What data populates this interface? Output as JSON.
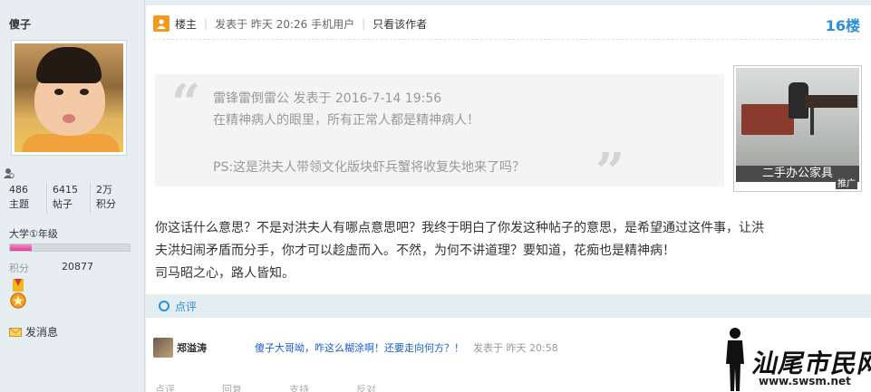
{
  "user": {
    "name": "傻子",
    "stats": [
      {
        "value": "486",
        "label": "主题"
      },
      {
        "value": "6415",
        "label": "帖子"
      },
      {
        "value": "2万",
        "label": "积分"
      }
    ],
    "grade": "大学①年级",
    "grade_progress": 0.18,
    "points_label": "积分",
    "points_value": "20877",
    "message_label": "发消息"
  },
  "post": {
    "host_label": "楼主",
    "posted_at": "发表于 昨天 20:26 手机用户",
    "author_only": "只看该作者",
    "floor": "16楼",
    "quote": {
      "line1": "雷锋雷倒雷公 发表于 2016-7-14 19:56",
      "line2": "在精神病人的眼里，所有正常人都是精神病人！",
      "line3": "PS:这是洪夫人带领文化版块虾兵蟹将收复失地来了吗？"
    },
    "body": {
      "line1": "你这话什么意思？不是对洪夫人有哪点意思吧？我终于明白了你发这种帖子的意思，是希望通过这件事，让洪",
      "line2": "夫洪妇闹矛盾而分手，你才可以趁虚而入。不然，为何不讲道理？要知道，花痴也是精神病！",
      "line3": "司马昭之心，路人皆知。"
    },
    "rate_label": "点评",
    "comment": {
      "user": "郑溢涛",
      "text": "傻子大哥呦，咋这么糊涂啊！还要走向何方？！",
      "time": "发表于 昨天 20:58"
    },
    "footer": [
      "点评",
      "回复",
      "支持",
      "反对"
    ]
  },
  "ad": {
    "caption": "二手办公家具",
    "tag": "推广"
  },
  "watermark": {
    "name": "汕尾市民网",
    "url": "www.swsm.net"
  },
  "colors": {
    "accent": "#2a8fd6",
    "host_icon": "#f19a1b",
    "comment_link": "#1b5fd1",
    "progress": "#de3f9c"
  }
}
